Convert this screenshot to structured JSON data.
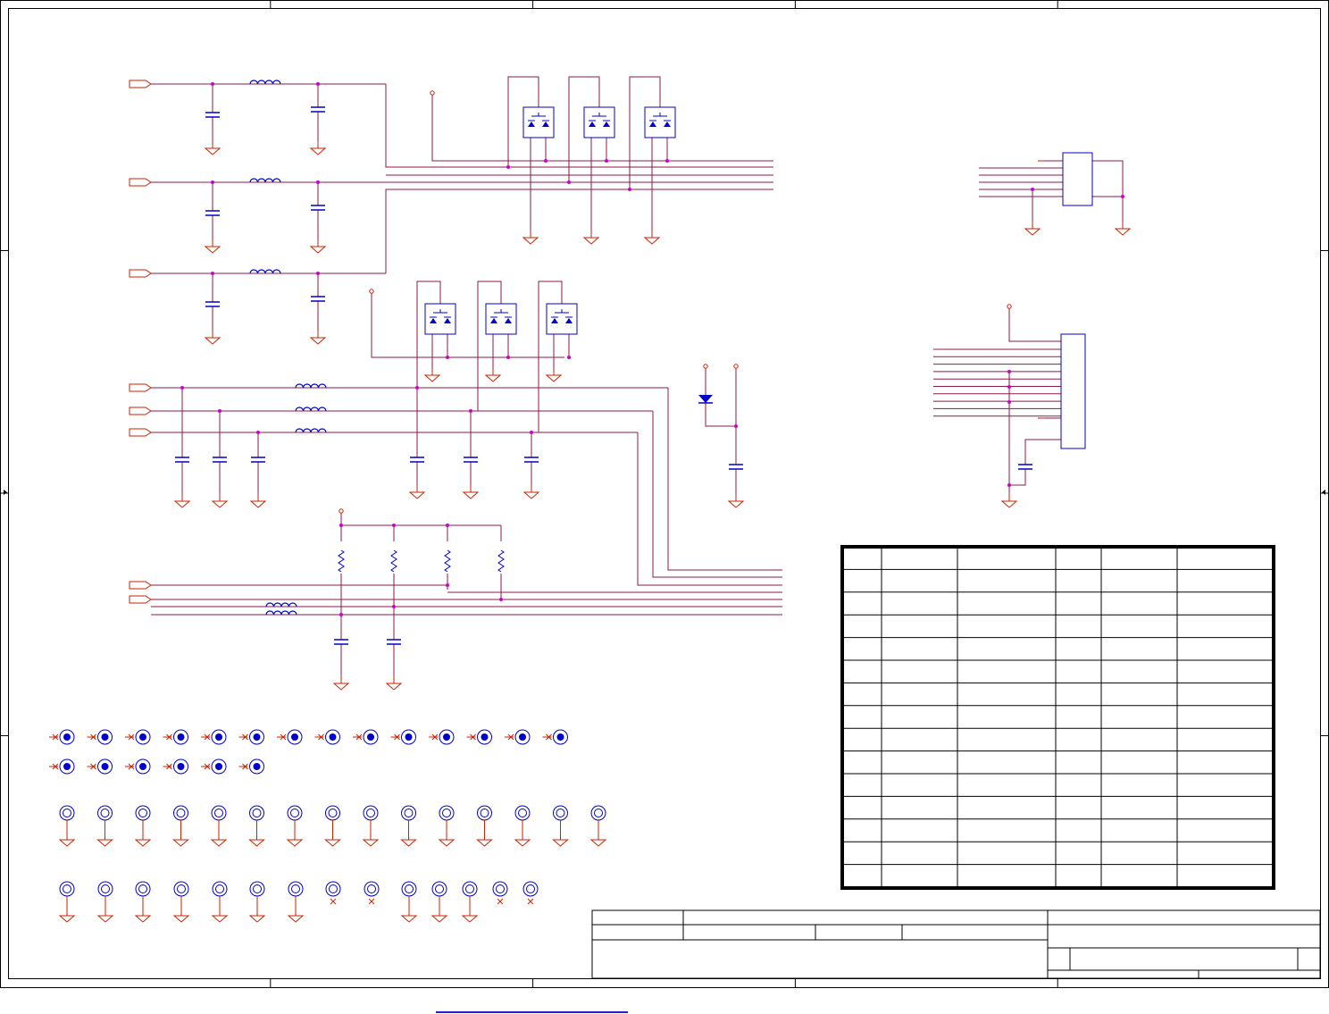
{
  "sheet": {
    "zone_columns": 5,
    "zone_rows": 4,
    "colors": {
      "border": "#000000",
      "wire": "#8b1a4a",
      "ground": "#cc2200",
      "component": "#0000cc",
      "junction": "#cc00cc",
      "table_border": "#000000"
    }
  },
  "schematic": {
    "left_power_filters": [
      {
        "id": "filter-1"
      },
      {
        "id": "filter-2"
      },
      {
        "id": "filter-3"
      }
    ],
    "tvs_array_groups": [
      {
        "id": "tvs-group-top",
        "count": 3
      },
      {
        "id": "tvs-group-middle",
        "count": 3
      }
    ],
    "signal_filters": [
      {
        "id": "signal-filter-1"
      },
      {
        "id": "signal-filter-2"
      },
      {
        "id": "signal-filter-3"
      }
    ],
    "pullup_resistors": 4,
    "connectors": [
      {
        "id": "connector-small",
        "pins": 6
      },
      {
        "id": "connector-large",
        "pins": 14
      }
    ],
    "mounting_holes_row1": 14,
    "mounting_holes_row2": 6,
    "fiducials_row1": 15,
    "fiducials_row2": 14,
    "fiducial_ground_pattern_row2": [
      true,
      true,
      true,
      true,
      true,
      true,
      true,
      false,
      false,
      true,
      true,
      true,
      false,
      false
    ]
  },
  "revision_table": {
    "rows": 15,
    "columns": 6
  },
  "title_block": {
    "fields": []
  },
  "footer_link": {
    "text": ""
  }
}
